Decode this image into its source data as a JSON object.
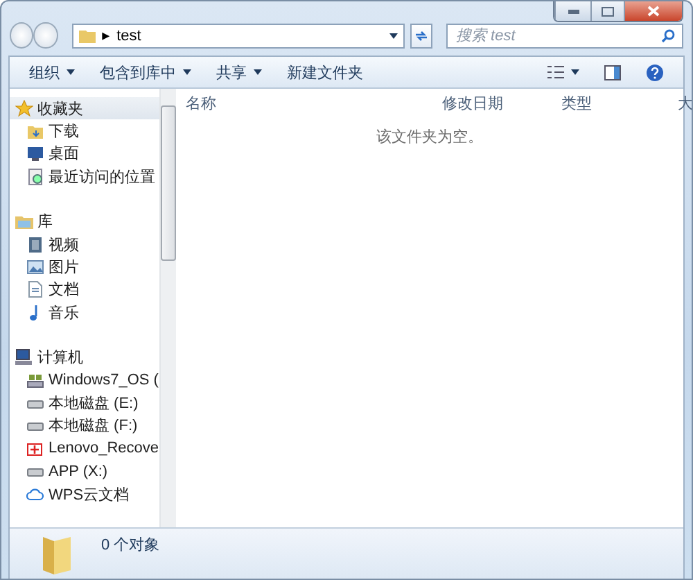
{
  "address_bar": {
    "path": "test",
    "arrow": "▸"
  },
  "search": {
    "placeholder": "搜索 test"
  },
  "toolbar": {
    "buttons": [
      {
        "label": "组织",
        "dropdown": true
      },
      {
        "label": "包含到库中",
        "dropdown": true
      },
      {
        "label": "共享",
        "dropdown": true
      },
      {
        "label": "新建文件夹",
        "dropdown": false
      }
    ]
  },
  "navigation": [
    {
      "label": "收藏夹",
      "kind": "star",
      "selected": true,
      "children": [
        {
          "label": "下载",
          "kind": "download",
          "selected": false
        },
        {
          "label": "桌面",
          "kind": "desktop",
          "selected": false
        },
        {
          "label": "最近访问的位置",
          "kind": "recent",
          "selected": false
        }
      ]
    },
    {
      "label": "库",
      "kind": "library",
      "selected": false,
      "children": [
        {
          "label": "视频",
          "kind": "video",
          "selected": false
        },
        {
          "label": "图片",
          "kind": "picture",
          "selected": false
        },
        {
          "label": "文档",
          "kind": "document",
          "selected": false
        },
        {
          "label": "音乐",
          "kind": "music",
          "selected": false
        }
      ]
    },
    {
      "label": "计算机",
      "kind": "computer",
      "selected": false,
      "children": [
        {
          "label": "Windows7_OS (",
          "kind": "os-drive",
          "selected": false
        },
        {
          "label": "本地磁盘 (E:)",
          "kind": "drive",
          "selected": false
        },
        {
          "label": "本地磁盘 (F:)",
          "kind": "drive",
          "selected": false
        },
        {
          "label": "Lenovo_Recove",
          "kind": "recovery",
          "selected": false
        },
        {
          "label": "APP (X:)",
          "kind": "drive",
          "selected": false
        },
        {
          "label": "WPS云文档",
          "kind": "cloud",
          "selected": false
        }
      ]
    }
  ],
  "file_list": {
    "columns": [
      "名称",
      "修改日期",
      "类型",
      "大"
    ],
    "empty_message": "该文件夹为空。"
  },
  "status_bar": {
    "count": "0 个对象"
  }
}
